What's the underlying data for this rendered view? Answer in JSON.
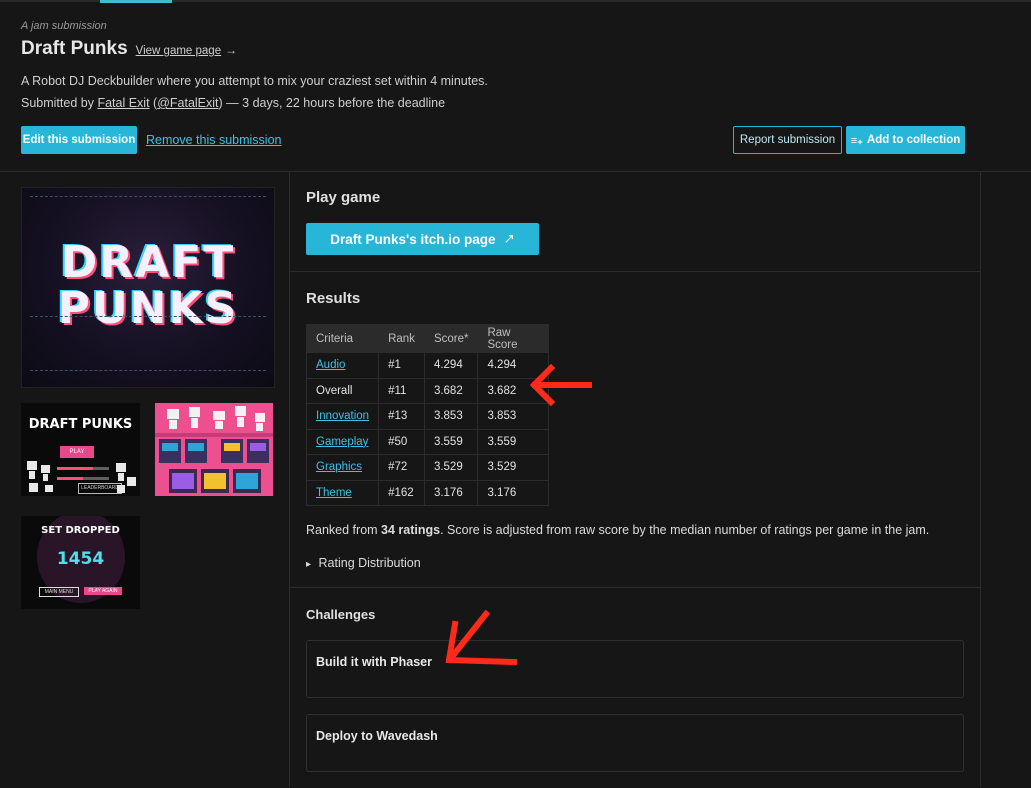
{
  "header": {
    "kicker": "A jam submission",
    "title": "Draft Punks",
    "view_link": "View game page",
    "view_arrow": "→",
    "description": "A Robot DJ Deckbuilder where you attempt to mix your craziest set within 4 minutes.",
    "submitted_prefix": "Submitted by",
    "author": "Fatal Exit",
    "handle": "@FatalExit",
    "submitted_suffix": "— 3 days, 22 hours before the deadline"
  },
  "actions": {
    "edit": "Edit this submission",
    "remove": "Remove this submission",
    "report": "Report submission",
    "add_collection": "Add to collection",
    "add_icon": "≡₊"
  },
  "screenshots": {
    "cover_title_line1": "DRAFT",
    "cover_title_line2": "PUNKS",
    "thumb1_title": "DRAFT PUNKS",
    "thumb1_play": "PLAY",
    "thumb1_leaderboard": "LEADERBOARD",
    "thumb3_title": "SET DROPPED",
    "thumb3_score": "1454",
    "thumb3_main_menu": "MAIN MENU",
    "thumb3_play_again": "PLAY AGAIN"
  },
  "play": {
    "heading": "Play game",
    "button": "Draft Punks's itch.io page",
    "button_icon": "↗"
  },
  "results": {
    "heading": "Results",
    "columns": [
      "Criteria",
      "Rank",
      "Score*",
      "Raw Score"
    ],
    "rows": [
      {
        "criteria": "Audio",
        "rank": "#1",
        "score": "4.294",
        "raw": "4.294",
        "link": true
      },
      {
        "criteria": "Overall",
        "rank": "#11",
        "score": "3.682",
        "raw": "3.682",
        "link": false
      },
      {
        "criteria": "Innovation",
        "rank": "#13",
        "score": "3.853",
        "raw": "3.853",
        "link": true
      },
      {
        "criteria": "Gameplay",
        "rank": "#50",
        "score": "3.559",
        "raw": "3.559",
        "link": true
      },
      {
        "criteria": "Graphics",
        "rank": "#72",
        "score": "3.529",
        "raw": "3.529",
        "link": true
      },
      {
        "criteria": "Theme",
        "rank": "#162",
        "score": "3.176",
        "raw": "3.176",
        "link": true
      }
    ],
    "ranked_prefix": "Ranked from",
    "ranked_count": "34 ratings",
    "ranked_suffix": ". Score is adjusted from raw score by the median number of ratings per game in the jam.",
    "distribution": "Rating Distribution",
    "distribution_icon": "▸"
  },
  "challenges": {
    "heading": "Challenges",
    "items": [
      "Build it with Phaser",
      "Deploy to Wavedash"
    ]
  },
  "annotations": {
    "arrow_color": "#ff2a1a"
  }
}
